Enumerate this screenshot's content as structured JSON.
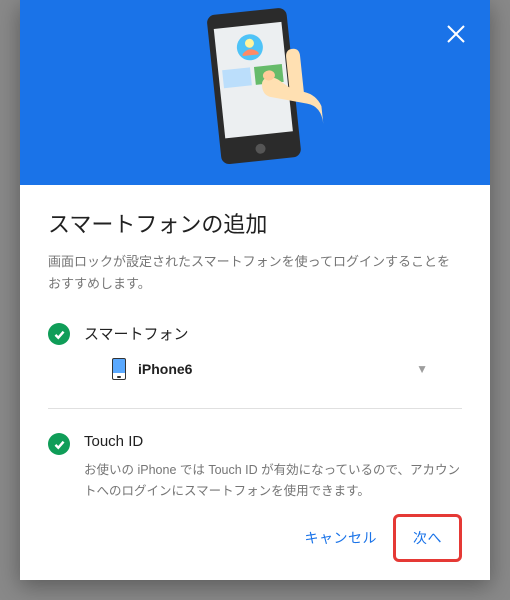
{
  "dialog": {
    "title": "スマートフォンの追加",
    "description": "画面ロックが設定されたスマートフォンを使ってログインすることをおすすめします。"
  },
  "smartphone": {
    "label": "スマートフォン",
    "device": "iPhone6"
  },
  "touchid": {
    "label": "Touch ID",
    "description": "お使いの iPhone では Touch ID が有効になっているので、アカウントへのログインにスマートフォンを使用できます。"
  },
  "actions": {
    "cancel": "キャンセル",
    "next": "次へ"
  }
}
